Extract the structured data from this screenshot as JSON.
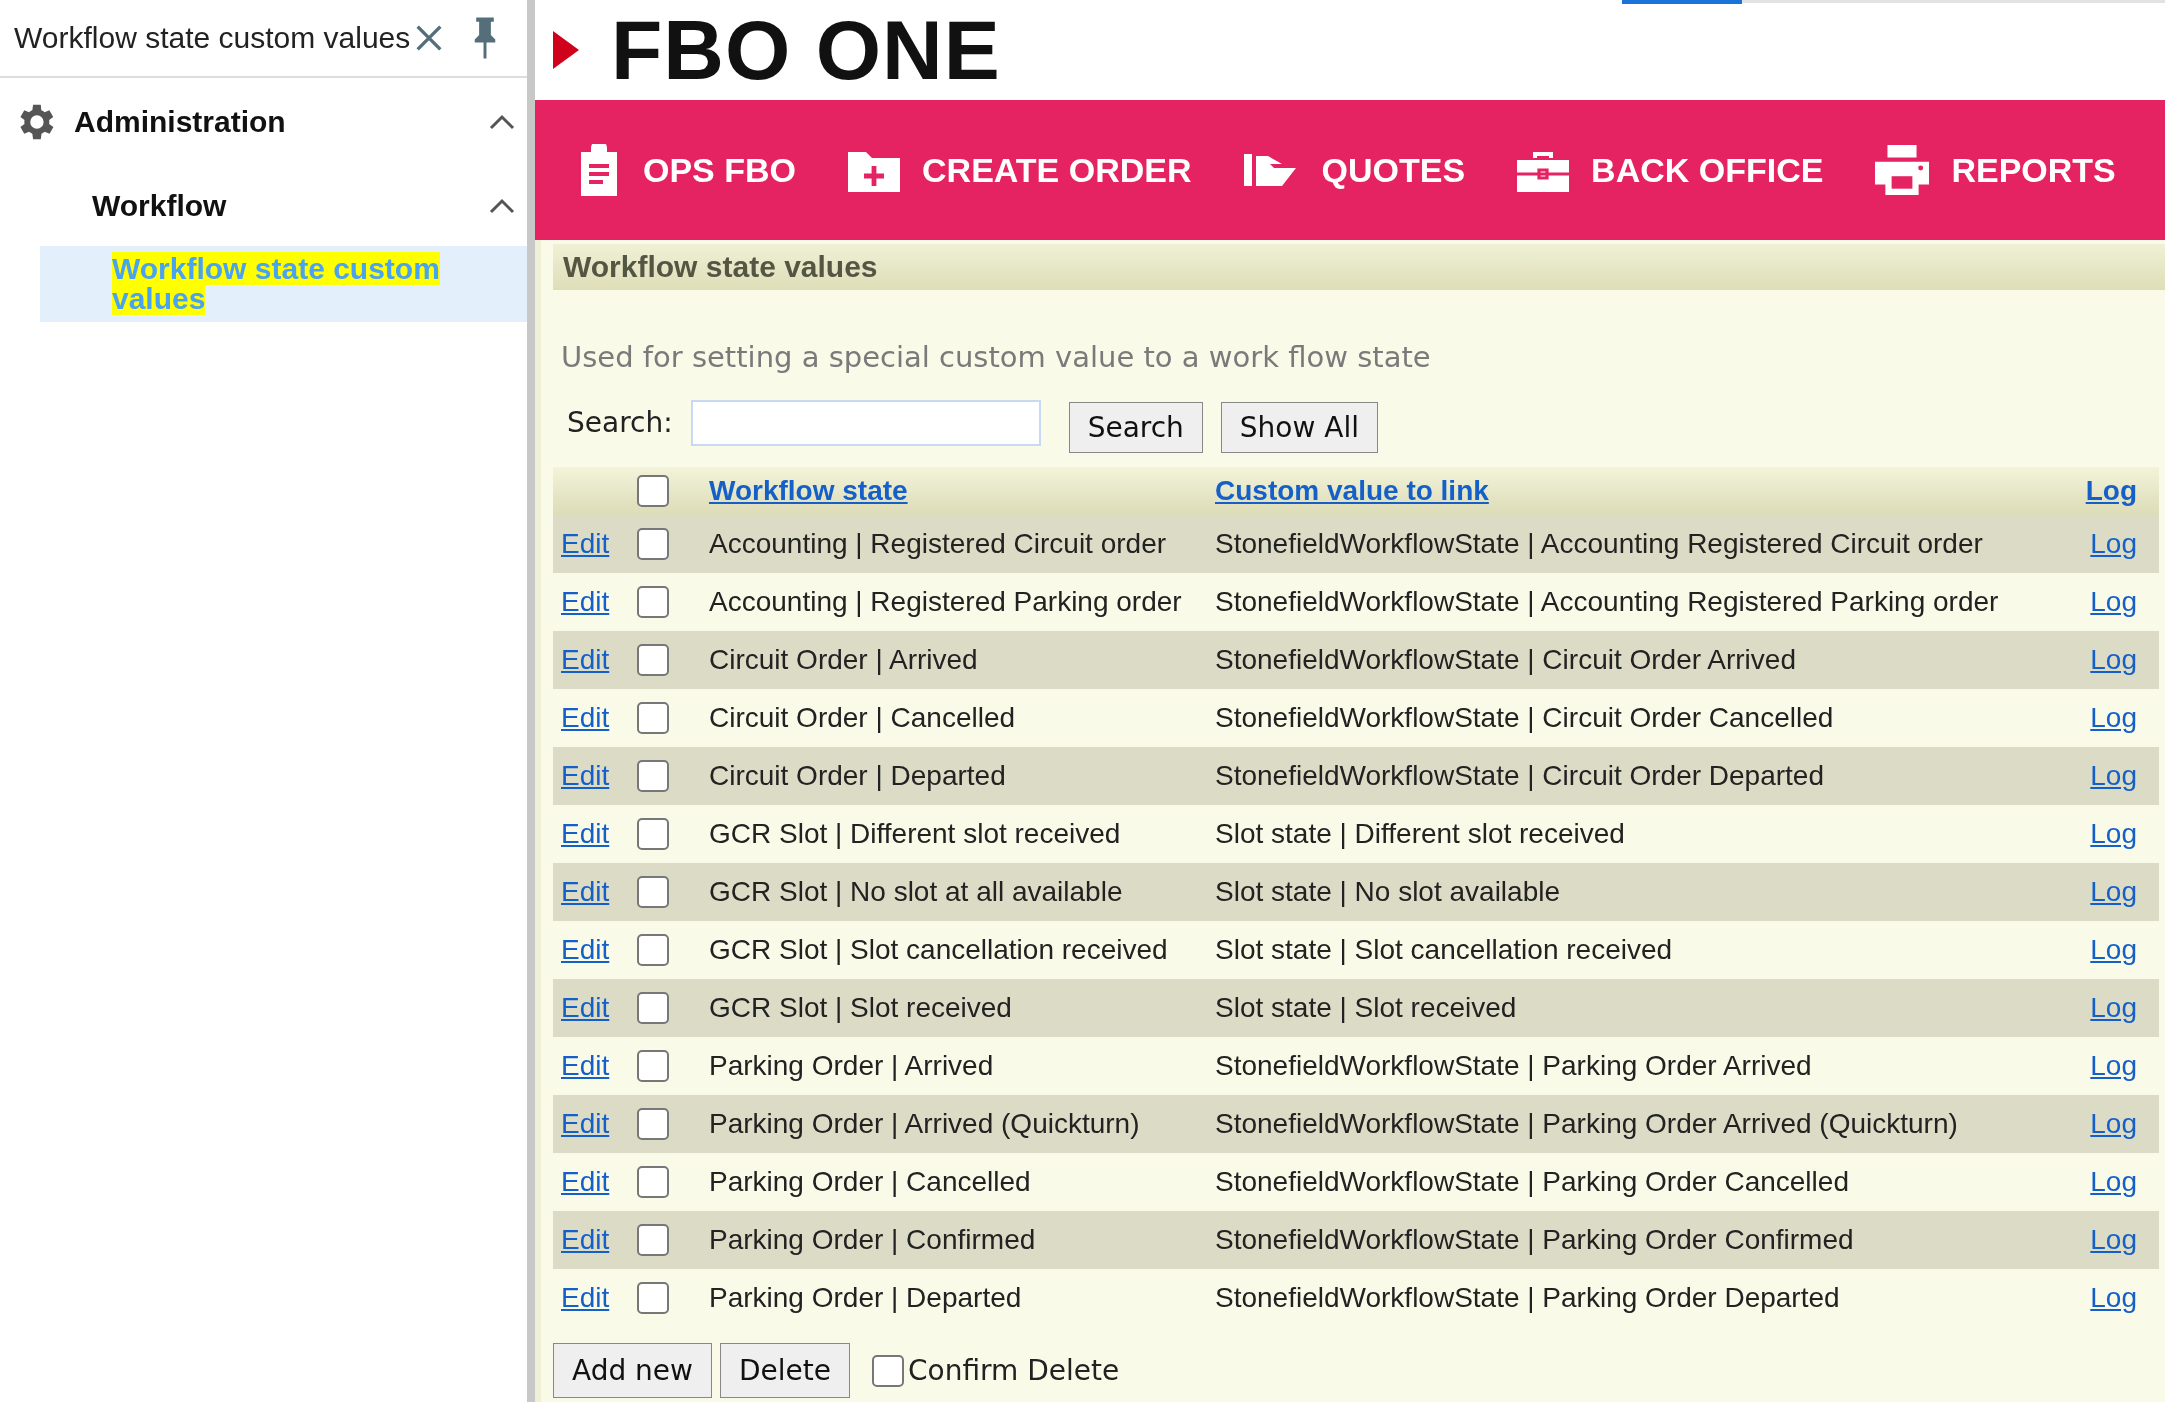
{
  "sidebar": {
    "title": "Workflow state custom values",
    "tree": [
      {
        "label": "Administration",
        "expanded": true,
        "children": [
          {
            "label": "Workflow",
            "expanded": true,
            "children": [
              {
                "label": "Workflow state custom values",
                "selected": true,
                "highlighted": true
              }
            ]
          }
        ]
      }
    ]
  },
  "logo": {
    "text": "FBO ONE"
  },
  "nav": [
    {
      "label": "OPS FBO"
    },
    {
      "label": "CREATE ORDER"
    },
    {
      "label": "QUOTES"
    },
    {
      "label": "BACK OFFICE"
    },
    {
      "label": "REPORTS"
    }
  ],
  "panel": {
    "title": "Workflow state values",
    "description": "Used for setting a special custom value to a work flow state",
    "search": {
      "label": "Search:",
      "buttons": [
        "Search",
        "Show All"
      ]
    },
    "table": {
      "select_all_checked": false,
      "columns": [
        "Workflow state",
        "Custom value to link",
        "Log"
      ],
      "rows": [
        {
          "edit": "Edit",
          "checked": false,
          "state": "Accounting | Registered Circuit order",
          "value": "StonefieldWorkflowState | Accounting Registered Circuit order",
          "log": "Log"
        },
        {
          "edit": "Edit",
          "checked": false,
          "state": "Accounting | Registered Parking order",
          "value": "StonefieldWorkflowState | Accounting Registered Parking order",
          "log": "Log"
        },
        {
          "edit": "Edit",
          "checked": false,
          "state": "Circuit Order | Arrived",
          "value": "StonefieldWorkflowState | Circuit Order Arrived",
          "log": "Log"
        },
        {
          "edit": "Edit",
          "checked": false,
          "state": "Circuit Order | Cancelled",
          "value": "StonefieldWorkflowState | Circuit Order Cancelled",
          "log": "Log"
        },
        {
          "edit": "Edit",
          "checked": false,
          "state": "Circuit Order | Departed",
          "value": "StonefieldWorkflowState | Circuit Order Departed",
          "log": "Log"
        },
        {
          "edit": "Edit",
          "checked": false,
          "state": "GCR Slot | Different slot received",
          "value": "Slot state | Different slot received",
          "log": "Log"
        },
        {
          "edit": "Edit",
          "checked": false,
          "state": "GCR Slot | No slot at all available",
          "value": "Slot state | No slot available",
          "log": "Log"
        },
        {
          "edit": "Edit",
          "checked": false,
          "state": "GCR Slot | Slot cancellation received",
          "value": "Slot state | Slot cancellation received",
          "log": "Log"
        },
        {
          "edit": "Edit",
          "checked": false,
          "state": "GCR Slot | Slot received",
          "value": "Slot state | Slot received",
          "log": "Log"
        },
        {
          "edit": "Edit",
          "checked": false,
          "state": "Parking Order | Arrived",
          "value": "StonefieldWorkflowState | Parking Order Arrived",
          "log": "Log"
        },
        {
          "edit": "Edit",
          "checked": false,
          "state": "Parking Order | Arrived (Quickturn)",
          "value": "StonefieldWorkflowState | Parking Order Arrived (Quickturn)",
          "log": "Log"
        },
        {
          "edit": "Edit",
          "checked": false,
          "state": "Parking Order | Cancelled",
          "value": "StonefieldWorkflowState | Parking Order Cancelled",
          "log": "Log"
        },
        {
          "edit": "Edit",
          "checked": false,
          "state": "Parking Order | Confirmed",
          "value": "StonefieldWorkflowState | Parking Order Confirmed",
          "log": "Log"
        },
        {
          "edit": "Edit",
          "checked": false,
          "state": "Parking Order | Departed",
          "value": "StonefieldWorkflowState | Parking Order Departed",
          "log": "Log"
        }
      ]
    },
    "footer": {
      "buttons": [
        "Add new",
        "Delete"
      ],
      "confirm": {
        "label": "Confirm Delete",
        "checked": false
      }
    }
  }
}
